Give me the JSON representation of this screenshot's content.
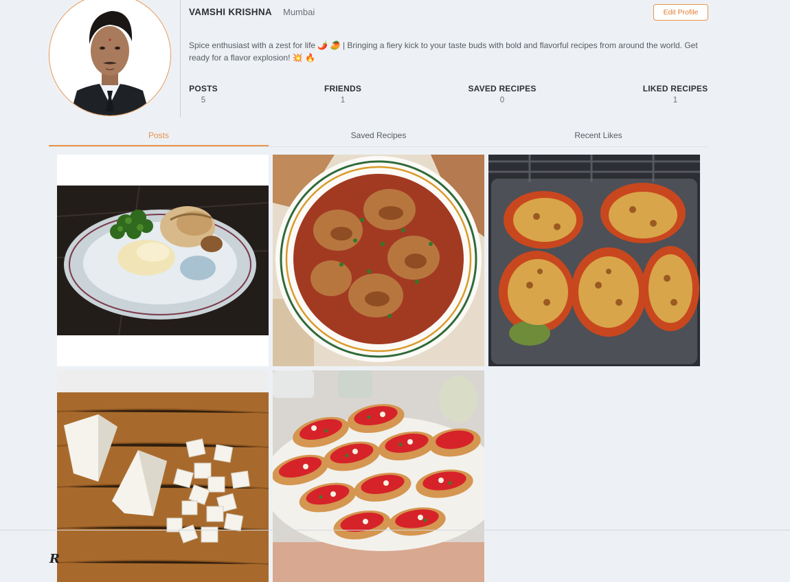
{
  "profile": {
    "name": "VAMSHI KRISHNA",
    "location": "Mumbai",
    "edit_label": "Edit Profile",
    "bio": "Spice enthusiast with a zest for life 🌶️ 🥭 | Bringing a fiery kick to your taste buds with bold and flavorful recipes from around the world. Get ready for a flavor explosion! 💥 🔥"
  },
  "stats": [
    {
      "label": "POSTS",
      "value": "5"
    },
    {
      "label": "FRIENDS",
      "value": "1"
    },
    {
      "label": "SAVED RECIPES",
      "value": "0"
    },
    {
      "label": "LIKED RECIPES",
      "value": "1"
    }
  ],
  "tabs": [
    {
      "label": "Posts",
      "active": true
    },
    {
      "label": "Saved Recipes",
      "active": false
    },
    {
      "label": "Recent Likes",
      "active": false
    }
  ],
  "posts": [
    {
      "name": "roast-chicken-plate"
    },
    {
      "name": "chicken-tomato-stew"
    },
    {
      "name": "stuffed-bell-peppers"
    },
    {
      "name": "paneer-cubes-board"
    },
    {
      "name": "tomato-bruschetta"
    }
  ],
  "footer": {
    "script_letter": "R"
  },
  "colors": {
    "accent": "#e8934a",
    "background": "#edf1f5"
  }
}
